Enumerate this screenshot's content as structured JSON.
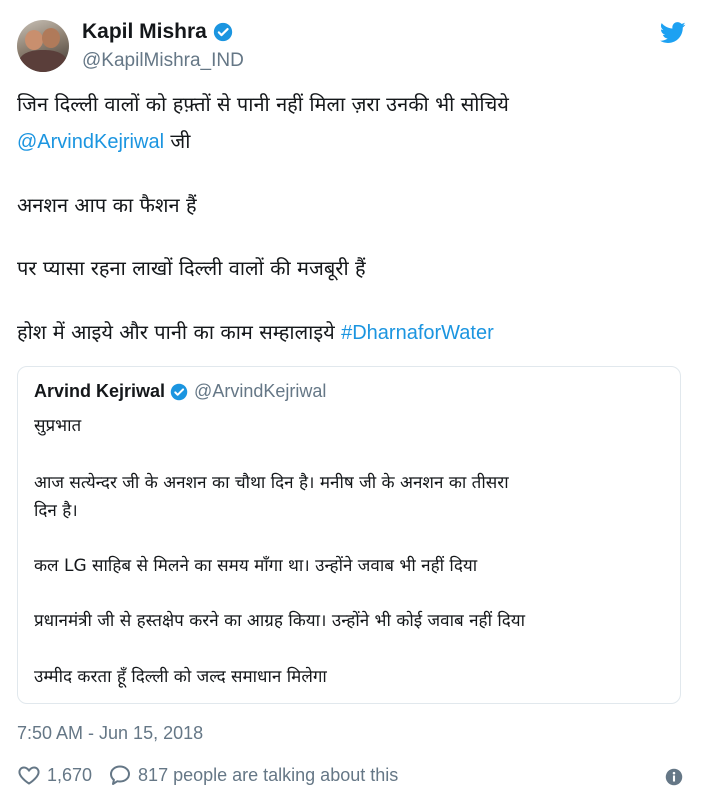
{
  "author": {
    "name": "Kapil Mishra",
    "handle": "@KapilMishra_IND"
  },
  "tweet": {
    "line1": "जिन दिल्ली वालों को हफ़्तों से पानी नहीं मिला ज़रा उनकी भी सोचिये",
    "mention": "@ArvindKejriwal",
    "mention_suffix": " जी",
    "line3": "अनशन आप का फैशन हैं",
    "line4": "पर प्यासा रहना लाखों दिल्ली वालों की मजबूरी हैं",
    "line5": "होश में आइये और पानी का काम सम्हालाइये ",
    "hashtag": "#DharnaforWater"
  },
  "quoted": {
    "name": "Arvind Kejriwal",
    "handle": "@ArvindKejriwal",
    "lines": [
      "सुप्रभात",
      "आज सत्येन्दर जी के अनशन का चौथा दिन है। मनीष जी के अनशन का तीसरा",
      "दिन है।",
      "कल LG साहिब से मिलने का समय माँगा था। उन्होंने जवाब भी नहीं दिया",
      "प्रधानमंत्री जी से हस्तक्षेप करने का आग्रह किया। उन्होंने भी कोई जवाब नहीं दिया",
      "उम्मीद करता हूँ दिल्ली को जल्द समाधान मिलेगा"
    ]
  },
  "meta": {
    "timestamp": "7:50 AM - Jun 15, 2018",
    "likes": "1,670",
    "replies_text": "817 people are talking about this"
  },
  "icons": {
    "verified": "verified-badge-icon",
    "brand": "twitter-bird-icon",
    "like": "heart-icon",
    "reply": "comment-bubble-icon",
    "info": "info-icon"
  },
  "colors": {
    "link": "#1b95e0",
    "muted": "#657786",
    "border": "#e1e8ed",
    "text": "#14171a"
  }
}
